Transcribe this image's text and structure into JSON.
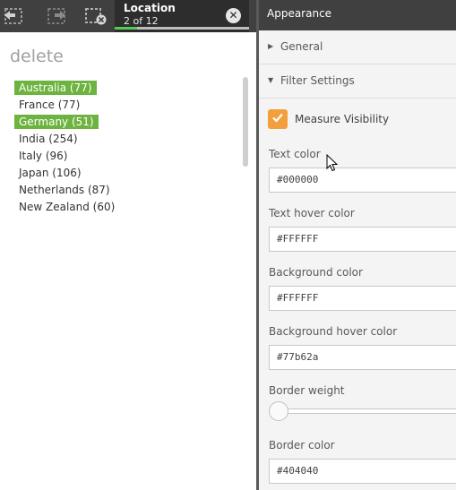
{
  "toolbar": {
    "step_back_icon": "step-back-icon",
    "step_forward_icon": "step-forward-icon",
    "clear_all_icon": "clear-all-selections-icon"
  },
  "selection": {
    "field": "Location",
    "count": "2 of 12",
    "progress": 0.1667,
    "progress_color": "#52cc52"
  },
  "list": {
    "title": "delete",
    "items": [
      {
        "label": "Australia (77)",
        "selected": true
      },
      {
        "label": "France (77)",
        "selected": false
      },
      {
        "label": "Germany (51)",
        "selected": true
      },
      {
        "label": "India (254)",
        "selected": false
      },
      {
        "label": "Italy (96)",
        "selected": false
      },
      {
        "label": "Japan (106)",
        "selected": false
      },
      {
        "label": "Netherlands (87)",
        "selected": false
      },
      {
        "label": "New Zealand (60)",
        "selected": false
      }
    ],
    "selected_color": "#6db33f"
  },
  "panel": {
    "header": "Appearance",
    "sections": {
      "general": "General",
      "filter_settings": "Filter Settings"
    },
    "measure_visibility": {
      "label": "Measure Visibility",
      "checked": true,
      "accent": "#f3a03c"
    },
    "fields": {
      "text_color": {
        "label": "Text color",
        "value": "#000000"
      },
      "text_hover_color": {
        "label": "Text hover color",
        "value": "#FFFFFF"
      },
      "background_color": {
        "label": "Background color",
        "value": "#FFFFFF"
      },
      "background_hover_color": {
        "label": "Background hover color",
        "value": "#77b62a"
      },
      "border_weight": {
        "label": "Border weight",
        "value": 0
      },
      "border_color": {
        "label": "Border color",
        "value": "#404040"
      }
    }
  }
}
